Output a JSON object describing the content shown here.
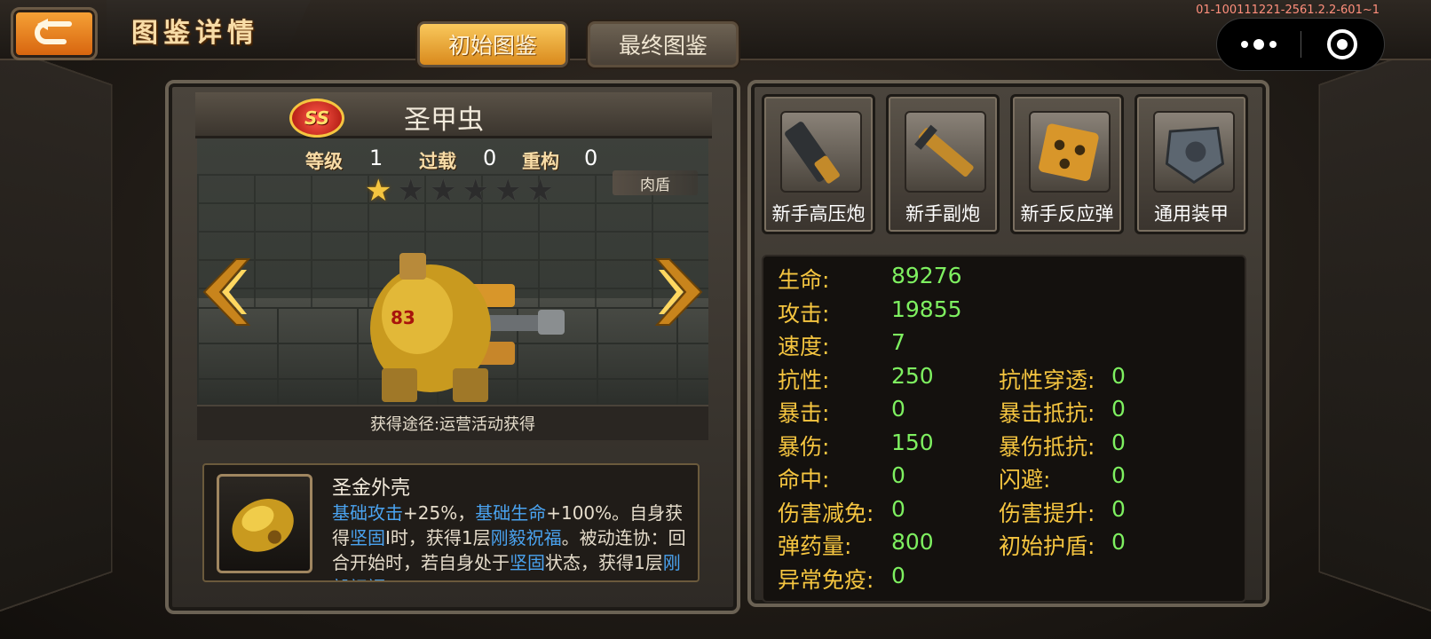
{
  "header": {
    "page_title": "图鉴详情",
    "tabs": [
      {
        "label": "初始图鉴",
        "active": true
      },
      {
        "label": "最终图鉴",
        "active": false
      }
    ],
    "version": "01-100111221-2561.2.2-601~1"
  },
  "mech": {
    "rank": "SS",
    "name": "圣甲虫",
    "level_label": "等级",
    "level": "1",
    "overload_label": "过载",
    "overload": "0",
    "rebuild_label": "重构",
    "rebuild": "0",
    "stars_filled": 1,
    "stars_total": 6,
    "role": "肉盾",
    "source": "获得途径:运营活动获得"
  },
  "skill": {
    "name": "圣金外壳",
    "desc_parts": [
      {
        "text": "基础攻击",
        "hl": true
      },
      {
        "text": "+25%，",
        "hl": false
      },
      {
        "text": "基础生命",
        "hl": true
      },
      {
        "text": "+100%。自身获得",
        "hl": false
      },
      {
        "text": "坚固",
        "hl": true
      },
      {
        "text": "I时，获得1层",
        "hl": false
      },
      {
        "text": "刚毅祝福",
        "hl": true
      },
      {
        "text": "。被动连协：回合开始时，若自身处于",
        "hl": false
      },
      {
        "text": "坚固",
        "hl": true
      },
      {
        "text": "状态，获得1层",
        "hl": false
      },
      {
        "text": "刚毅祝福",
        "hl": true
      }
    ]
  },
  "equipment": [
    {
      "label": "新手高压炮",
      "icon": "cannon-icon"
    },
    {
      "label": "新手副炮",
      "icon": "rifle-icon"
    },
    {
      "label": "新手反应弹",
      "icon": "missile-pod-icon"
    },
    {
      "label": "通用装甲",
      "icon": "armor-icon"
    }
  ],
  "attributes_left": [
    {
      "label": "生命:",
      "value": "89276"
    },
    {
      "label": "攻击:",
      "value": "19855"
    },
    {
      "label": "速度:",
      "value": "7"
    },
    {
      "label": "抗性:",
      "value": "250"
    },
    {
      "label": "暴击:",
      "value": "0"
    },
    {
      "label": "暴伤:",
      "value": "150"
    },
    {
      "label": "命中:",
      "value": "0"
    },
    {
      "label": "伤害减免:",
      "value": "0"
    },
    {
      "label": "弹药量:",
      "value": "800"
    },
    {
      "label": "异常免疫:",
      "value": "0"
    }
  ],
  "attributes_right": [
    {
      "label": "抗性穿透:",
      "value": "0"
    },
    {
      "label": "暴击抵抗:",
      "value": "0"
    },
    {
      "label": "暴伤抵抗:",
      "value": "0"
    },
    {
      "label": "闪避:",
      "value": "0"
    },
    {
      "label": "伤害提升:",
      "value": "0"
    },
    {
      "label": "初始护盾:",
      "value": "0"
    }
  ],
  "colors": {
    "accent_orange": "#f7a438",
    "label_gold": "#f5c540",
    "value_green": "#7ef060",
    "skill_highlight": "#4aa3f0"
  }
}
